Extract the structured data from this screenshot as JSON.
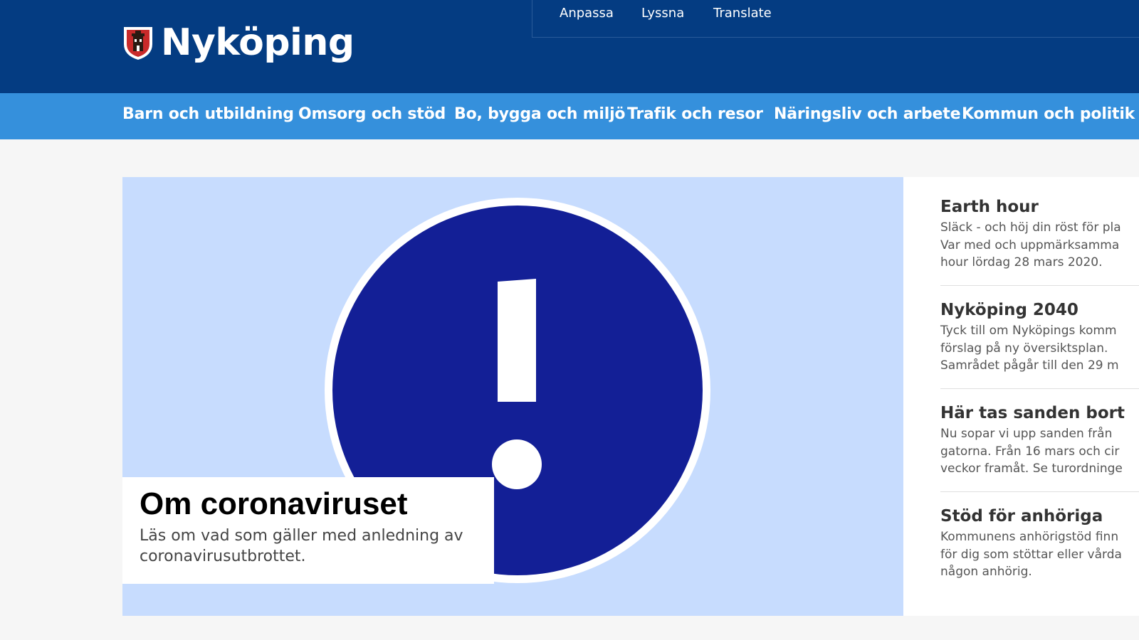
{
  "brand": {
    "name": "Nyköping",
    "header_color": "#043c82",
    "nav_color": "#3590dc"
  },
  "utility_links": [
    "Anpassa",
    "Lyssna",
    "Translate"
  ],
  "main_nav": [
    "Barn och utbildning",
    "Omsorg och stöd",
    "Bo, bygga och miljö",
    "Trafik och resor",
    "Näringsliv och arbete",
    "Kommun och politik"
  ],
  "hero": {
    "title": "Om coronaviruset",
    "text_line1": "Läs om vad som gäller med anledning av",
    "text_line2": "coronavirusutbrottet.",
    "icon": "exclamation-circle-icon",
    "icon_color": "#131f96",
    "background": "#c7dcfe"
  },
  "news": [
    {
      "title": "Earth hour",
      "lines": [
        "Släck - och höj din röst för pla",
        "Var med och uppmärksamma",
        "hour lördag 28 mars 2020."
      ]
    },
    {
      "title": "Nyköping 2040",
      "lines": [
        "Tyck till om Nyköpings komm",
        "förslag på ny översiktsplan.",
        "Samrådet pågår till den 29 m"
      ]
    },
    {
      "title": "Här tas sanden bort",
      "lines": [
        "Nu sopar vi upp sanden från",
        "gatorna. Från 16 mars och cir",
        "veckor framåt. Se turordninge"
      ]
    },
    {
      "title": "Stöd för anhöriga",
      "lines": [
        "Kommunens anhörigstöd finn",
        "för dig som stöttar eller vårda",
        "någon anhörig."
      ]
    }
  ]
}
